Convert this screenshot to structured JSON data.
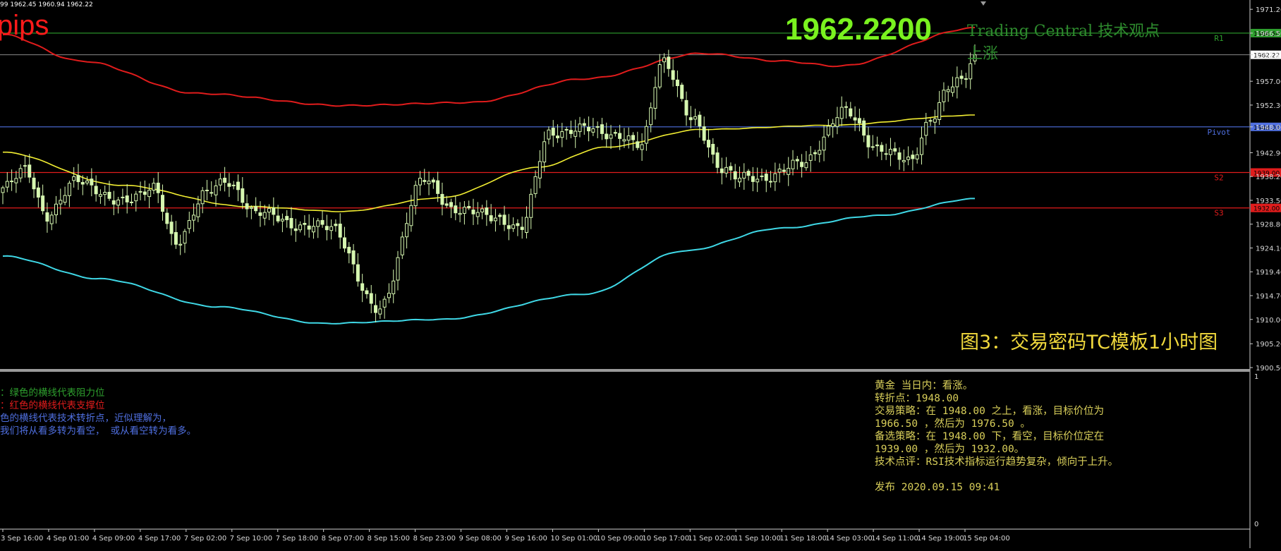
{
  "header": {
    "ohlc_text": "99 1962.45 1960.94 1962.22",
    "pips_text": "pips",
    "price_big": "1962.2200",
    "tc_title": "Trading Central 技术观点",
    "trend_label": "上涨",
    "caption": "图3：交易密码TC模板1小时图"
  },
  "colors": {
    "resistance": "#2ea02e",
    "support": "#e01c1c",
    "pivot": "#4f6fe0",
    "upper_band": "#e01c1c",
    "moving_average": "#f2ee32",
    "lower_band": "#3fd8e6",
    "bull_candle": "#d6f7b0",
    "bear_candle": "#d6f7b0",
    "axis_text": "#d8d8d8",
    "big_price": "#7af21f",
    "caption_text": "#f0d83c"
  },
  "chart_data": {
    "type": "candlestick",
    "title": "",
    "x_tick_labels": [
      "3 Sep 16:00",
      "4 Sep 01:00",
      "4 Sep 09:00",
      "4 Sep 17:00",
      "7 Sep 02:00",
      "7 Sep 10:00",
      "7 Sep 18:00",
      "8 Sep 07:00",
      "8 Sep 15:00",
      "8 Sep 23:00",
      "9 Sep 08:00",
      "9 Sep 16:00",
      "10 Sep 01:00",
      "10 Sep 09:00",
      "10 Sep 17:00",
      "11 Sep 02:00",
      "11 Sep 10:00",
      "11 Sep 18:00",
      "14 Sep 03:00",
      "14 Sep 11:00",
      "14 Sep 19:00",
      "15 Sep 04:00"
    ],
    "y_tick_labels": [
      "1971.20",
      "1966.50",
      "1962.22",
      "1957.00",
      "1952.30",
      "1948.00",
      "1942.90",
      "1938.20",
      "1933.50",
      "1928.80",
      "1924.10",
      "1919.40",
      "1914.70",
      "1910.00",
      "1905.20",
      "1900.50"
    ],
    "ylim": [
      1900.5,
      1972.2
    ],
    "levels": [
      {
        "name": "R1",
        "value": 1966.5,
        "kind": "resistance"
      },
      {
        "name": "Pivot",
        "value": 1948.0,
        "kind": "pivot"
      },
      {
        "name": "S2",
        "value": 1939.0,
        "kind": "support"
      },
      {
        "name": "S3",
        "value": 1932.0,
        "kind": "support"
      }
    ],
    "current_price": 1962.22,
    "indicator_panel": {
      "ylim": [
        0,
        1
      ],
      "tick_labels": [
        "1",
        "0"
      ]
    }
  },
  "notes_left": [
    {
      "text": "：绿色的横线代表阻力位",
      "kind": "resistance"
    },
    {
      "text": "：红色的横线代表支撑位",
      "kind": "support"
    },
    {
      "text": "色的横线代表技术转折点，近似理解为，",
      "kind": "pivot"
    },
    {
      "text": "我们将从看多转为看空， 或从看空转为看多。",
      "kind": "pivot"
    }
  ],
  "analysis": [
    "黄金 当日内：看涨。",
    "转折点：1948.00",
    "交易策略：在 1948.00 之上，看涨，目标价位为",
    "1966.50 ，然后为 1976.50 。",
    "备选策略：在 1948.00 下，看空，目标价位定在",
    "1939.00 ，然后为 1932.00。",
    "技术点评：RSI技术指标运行趋势复杂，倾向于上升。",
    "",
    "发布 2020.09.15 09:41"
  ]
}
